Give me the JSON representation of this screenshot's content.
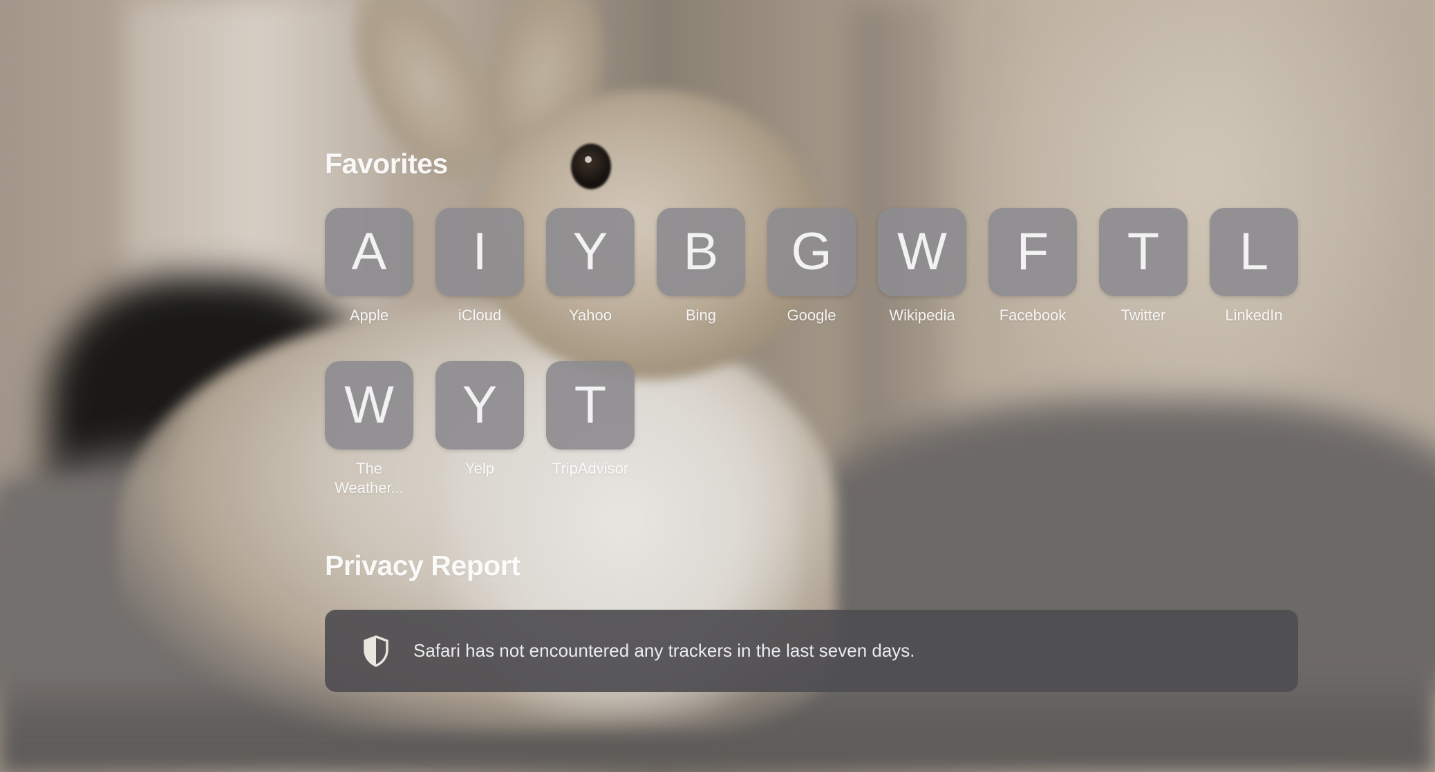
{
  "favorites": {
    "title": "Favorites",
    "items": [
      {
        "letter": "A",
        "label": "Apple"
      },
      {
        "letter": "I",
        "label": "iCloud"
      },
      {
        "letter": "Y",
        "label": "Yahoo"
      },
      {
        "letter": "B",
        "label": "Bing"
      },
      {
        "letter": "G",
        "label": "Google"
      },
      {
        "letter": "W",
        "label": "Wikipedia"
      },
      {
        "letter": "F",
        "label": "Facebook"
      },
      {
        "letter": "T",
        "label": "Twitter"
      },
      {
        "letter": "L",
        "label": "LinkedIn"
      },
      {
        "letter": "W",
        "label": "The Weather..."
      },
      {
        "letter": "Y",
        "label": "Yelp"
      },
      {
        "letter": "T",
        "label": "TripAdvisor"
      }
    ]
  },
  "privacy": {
    "title": "Privacy Report",
    "message": "Safari has not encountered any trackers in the last seven days.",
    "icon": "shield-icon"
  },
  "colors": {
    "tile": "#8e8c90",
    "card": "#4e4d50",
    "text": "#ffffff"
  }
}
